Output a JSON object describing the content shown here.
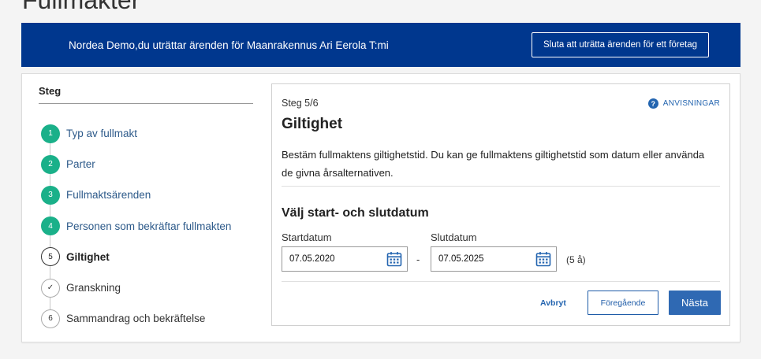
{
  "page": {
    "title": "Fullmakter"
  },
  "banner": {
    "text": "Nordea Demo,du uträttar ärenden för Maanrakennus Ari Eerola T:mi",
    "button_label": "Sluta att uträtta ärenden för ett företag"
  },
  "steps": {
    "title": "Steg",
    "items": [
      {
        "number": "1",
        "label": "Typ av fullmakt",
        "state": "done"
      },
      {
        "number": "2",
        "label": "Parter",
        "state": "done"
      },
      {
        "number": "3",
        "label": "Fullmaktsärenden",
        "state": "done"
      },
      {
        "number": "4",
        "label": "Personen som bekräftar fullmakten",
        "state": "done"
      },
      {
        "number": "5",
        "label": "Giltighet",
        "state": "current"
      },
      {
        "number": "✓",
        "label": "Granskning",
        "state": "todo"
      },
      {
        "number": "6",
        "label": "Sammandrag och bekräftelse",
        "state": "todo"
      }
    ]
  },
  "form": {
    "step_count": "Steg 5/6",
    "help_label": "ANVISNINGAR",
    "help_icon": "question-icon",
    "title": "Giltighet",
    "description": "Bestäm fullmaktens giltighetstid. Du kan ge fullmaktens giltighetstid som datum eller använda de givna årsalternativen.",
    "section_title": "Välj start- och slutdatum",
    "start_label": "Startdatum",
    "start_value": "07.05.2020",
    "separator": "-",
    "end_label": "Slutdatum",
    "end_value": "07.05.2025",
    "duration": "(5 å)",
    "calendar_icon": "calendar-icon",
    "cancel_label": "Avbryt",
    "prev_label": "Föregående",
    "next_label": "Nästa"
  },
  "colors": {
    "banner": "#00378e",
    "step_done": "#1ab089",
    "link": "#2465b0",
    "primary_button": "#2f69b3"
  }
}
